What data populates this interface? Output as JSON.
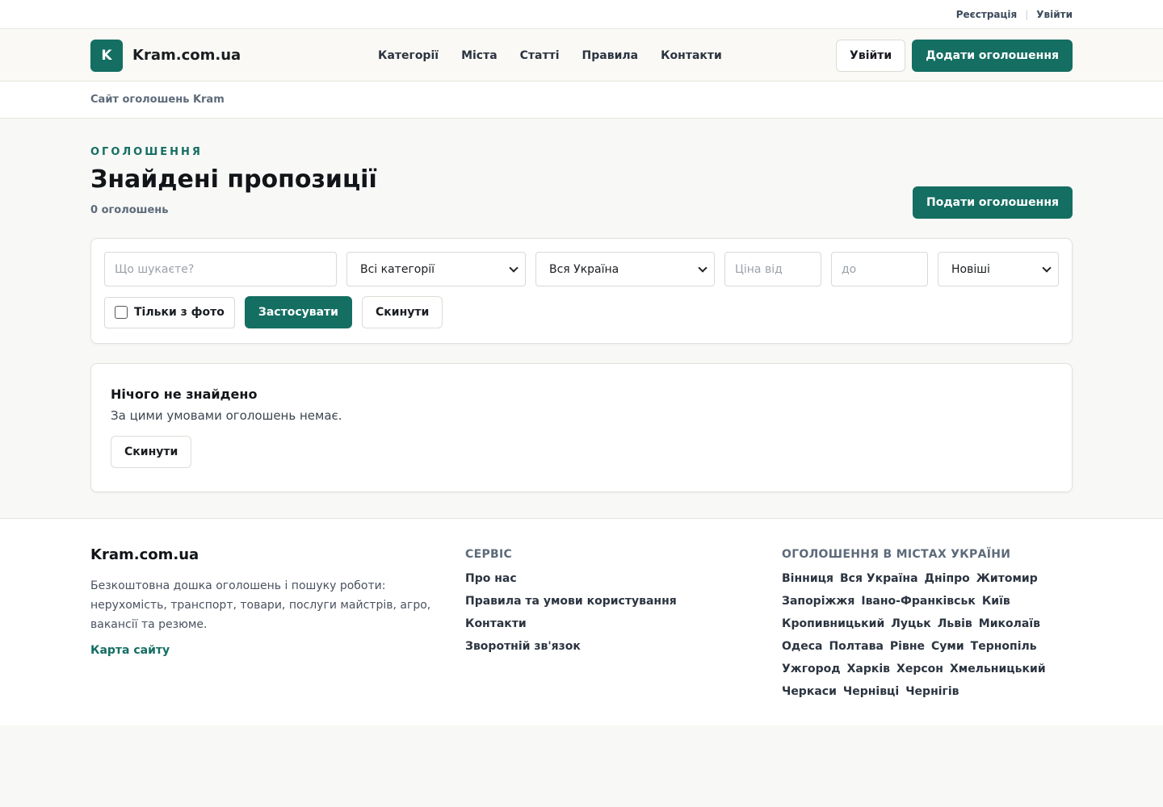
{
  "topbar": {
    "register": "Реєстрація",
    "separator": "|",
    "login": "Увійти"
  },
  "header": {
    "logo_letter": "K",
    "logo_text": "Kram.com.ua",
    "nav": [
      "Категорії",
      "Міста",
      "Статті",
      "Правила",
      "Контакти"
    ],
    "login_button": "Увійти",
    "add_button": "Додати оголошення"
  },
  "breadcrumb": "Сайт оголошень Kram",
  "pagehead": {
    "eyebrow": "ОГОЛОШЕННЯ",
    "title": "Знайдені пропозиції",
    "count": "0 оголошень",
    "submit_button": "Подати оголошення"
  },
  "filters": {
    "search_placeholder": "Що шукаєте?",
    "category": "Всі категорії",
    "region": "Вся Україна",
    "price_from_placeholder": "Ціна від",
    "price_to_placeholder": "до",
    "sort": "Новіші",
    "photo_only": "Тільки з фото",
    "apply": "Застосувати",
    "reset": "Скинути"
  },
  "empty": {
    "title": "Нічого не знайдено",
    "text": "За цими умовами оголошень немає.",
    "reset": "Скинути"
  },
  "footer": {
    "brand": "Kram.com.ua",
    "description": "Безкоштовна дошка оголошень і пошуку роботи: нерухомість, транспорт, товари, послуги майстрів, агро, вакансії та резюме.",
    "sitemap": "Карта сайту",
    "service_heading": "СЕРВІС",
    "service_links": [
      "Про нас",
      "Правила та умови користування",
      "Контакти",
      "Зворотній зв'язок"
    ],
    "cities_heading": "ОГОЛОШЕННЯ В МІСТАХ УКРАЇНИ",
    "cities": [
      "Вінниця",
      "Вся Україна",
      "Дніпро",
      "Житомир",
      "Запоріжжя",
      "Івано-Франківськ",
      "Київ",
      "Кропивницький",
      "Луцьк",
      "Львів",
      "Миколаїв",
      "Одеса",
      "Полтава",
      "Рівне",
      "Суми",
      "Тернопіль",
      "Ужгород",
      "Харків",
      "Херсон",
      "Хмельницький",
      "Черкаси",
      "Чернівці",
      "Чернігів"
    ]
  },
  "colors": {
    "brand": "#146e62",
    "background": "#f8f8f6"
  }
}
